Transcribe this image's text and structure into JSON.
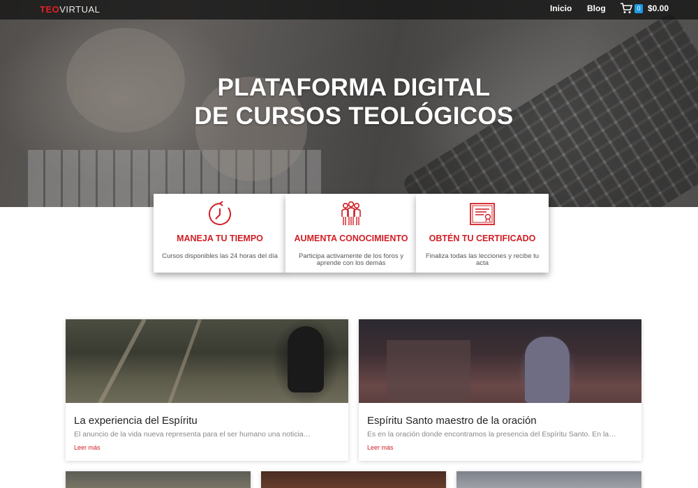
{
  "navbar": {
    "logo_red": "TEO",
    "logo_white": "VIRTUAL",
    "links": [
      "Inicio",
      "Blog"
    ],
    "cart_count": "0",
    "cart_total": "$0.00"
  },
  "hero": {
    "title_line1": "PLATAFORMA DIGITAL",
    "title_line2": "DE CURSOS TEOLÓGICOS"
  },
  "features": [
    {
      "icon": "clock-icon",
      "title": "MANEJA TU TIEMPO",
      "desc": "Cursos disponibles las 24 horas del día"
    },
    {
      "icon": "group-icon",
      "title": "AUMENTA CONOCIMIENTO",
      "desc": "Participa activamente de los foros y aprende con los demás"
    },
    {
      "icon": "certificate-icon",
      "title": "OBTÉN TU CERTIFICADO",
      "desc": "Finaliza todas las lecciones y recibe tu acta"
    }
  ],
  "posts": [
    {
      "title": "La experiencia del Espíritu",
      "excerpt": "El anuncio de la vida nueva representa para el ser humano una noticia…",
      "more": "Leer más"
    },
    {
      "title": "Espíritu Santo maestro de la oración",
      "excerpt": "Es en la oración donde encontramos la presencia del Espíritu Santo. En la…",
      "more": "Leer más"
    }
  ],
  "colors": {
    "accent": "#d11d24",
    "badge": "#1e9be6"
  }
}
